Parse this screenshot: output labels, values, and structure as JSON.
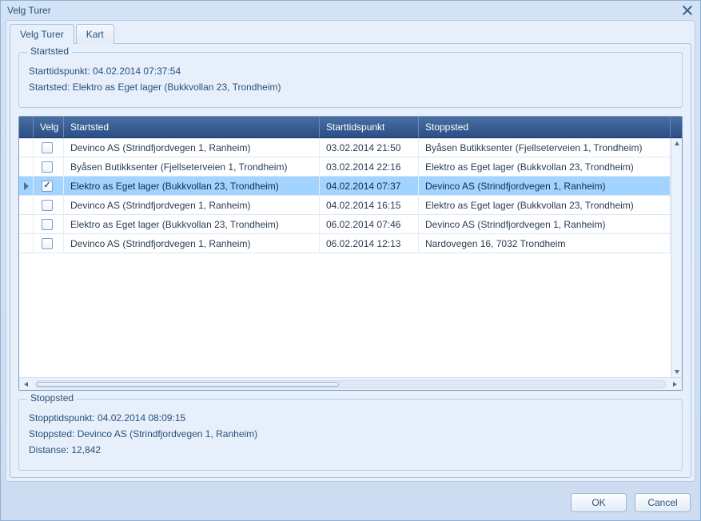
{
  "window": {
    "title": "Velg Turer"
  },
  "tabs": [
    {
      "label": "Velg Turer"
    },
    {
      "label": "Kart"
    }
  ],
  "startsted": {
    "legend": "Startsted",
    "line1": "Starttidspunkt: 04.02.2014 07:37:54",
    "line2": "Startsted: Elektro as Eget lager (Bukkvollan 23, Trondheim)"
  },
  "grid": {
    "headers": {
      "velg": "Velg",
      "startsted": "Startsted",
      "starttidspunkt": "Starttidspunkt",
      "stoppsted": "Stoppsted"
    },
    "rows": [
      {
        "selected": false,
        "checked": false,
        "startsted": "Devinco AS (Strindfjordvegen 1, Ranheim)",
        "starttidspunkt": "03.02.2014 21:50",
        "stoppsted": "Byåsen Butikksenter (Fjellseterveien 1, Trondheim)"
      },
      {
        "selected": false,
        "checked": false,
        "startsted": "Byåsen Butikksenter (Fjellseterveien 1, Trondheim)",
        "starttidspunkt": "03.02.2014 22:16",
        "stoppsted": "Elektro as Eget lager (Bukkvollan 23, Trondheim)"
      },
      {
        "selected": true,
        "checked": true,
        "startsted": "Elektro as Eget lager (Bukkvollan 23, Trondheim)",
        "starttidspunkt": "04.02.2014 07:37",
        "stoppsted": "Devinco AS (Strindfjordvegen 1, Ranheim)"
      },
      {
        "selected": false,
        "checked": false,
        "startsted": "Devinco AS (Strindfjordvegen 1, Ranheim)",
        "starttidspunkt": "04.02.2014 16:15",
        "stoppsted": "Elektro as Eget lager (Bukkvollan 23, Trondheim)"
      },
      {
        "selected": false,
        "checked": false,
        "startsted": "Elektro as Eget lager (Bukkvollan 23, Trondheim)",
        "starttidspunkt": "06.02.2014 07:46",
        "stoppsted": "Devinco AS (Strindfjordvegen 1, Ranheim)"
      },
      {
        "selected": false,
        "checked": false,
        "startsted": "Devinco AS (Strindfjordvegen 1, Ranheim)",
        "starttidspunkt": "06.02.2014 12:13",
        "stoppsted": "Nardovegen 16, 7032 Trondheim"
      }
    ]
  },
  "stoppsted": {
    "legend": "Stoppsted",
    "line1": "Stopptidspunkt: 04.02.2014 08:09:15",
    "line2": "Stoppsted: Devinco AS (Strindfjordvegen 1, Ranheim)",
    "line3": "Distanse: 12,842"
  },
  "buttons": {
    "ok": "OK",
    "cancel": "Cancel"
  }
}
